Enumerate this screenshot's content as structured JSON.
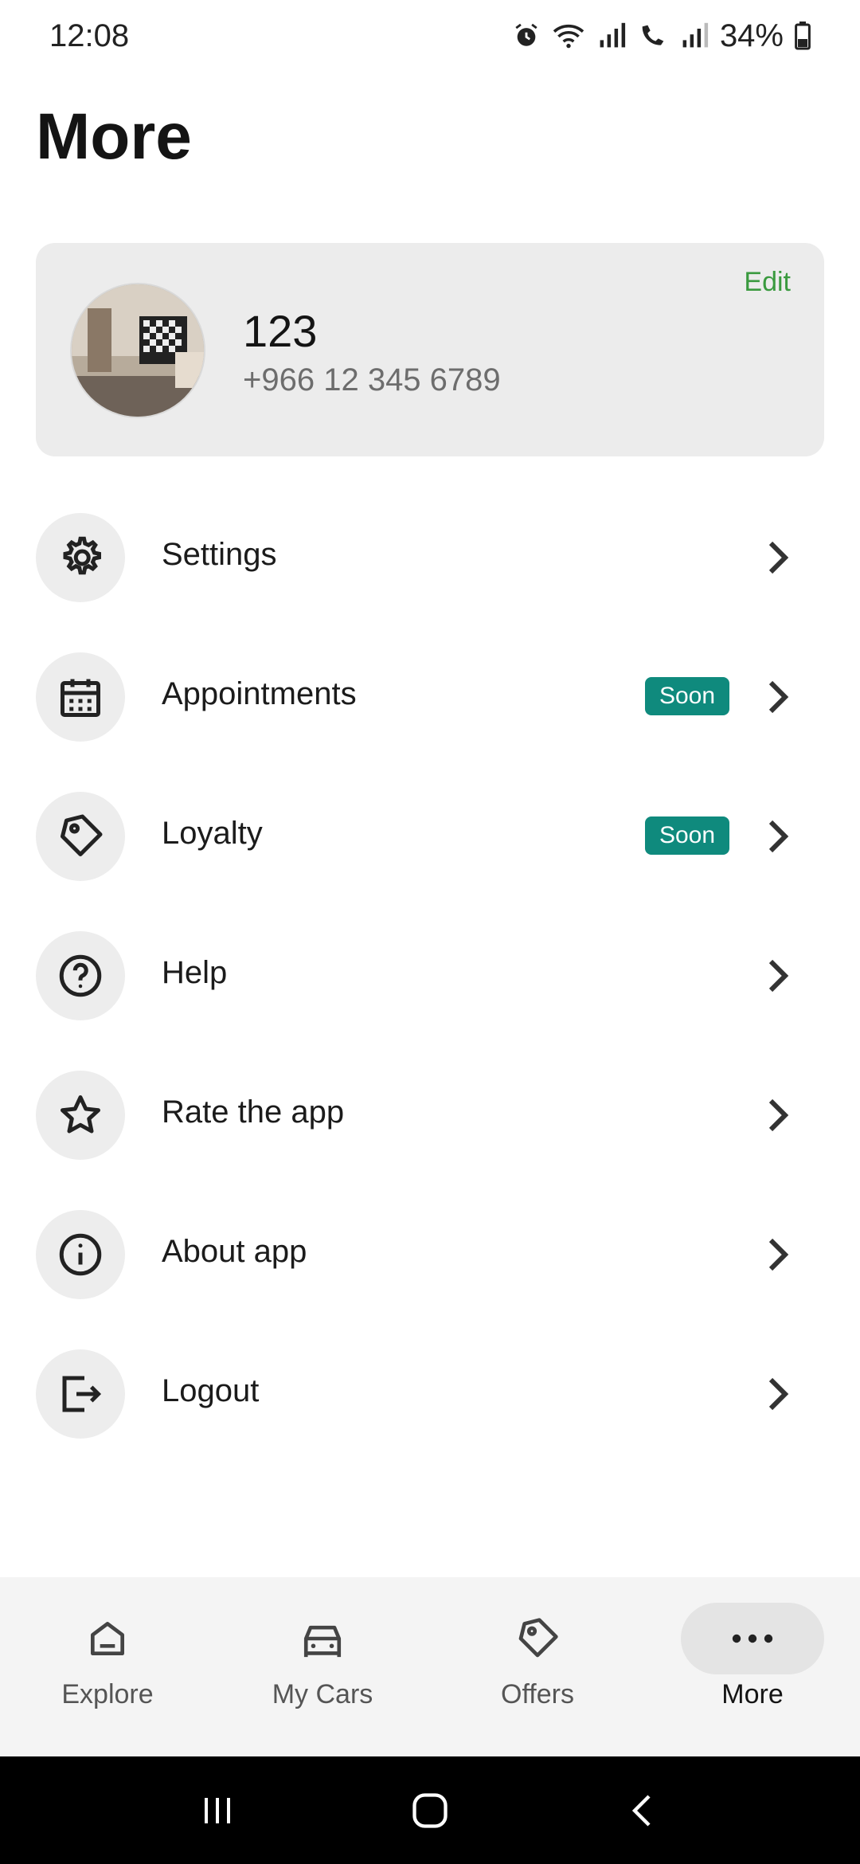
{
  "status_bar": {
    "time": "12:08",
    "battery": "34%"
  },
  "page": {
    "title": "More"
  },
  "profile": {
    "name": "123",
    "phone": "+966 12 345 6789",
    "edit_label": "Edit"
  },
  "menu": {
    "items": [
      {
        "label": "Settings",
        "icon": "gear-icon"
      },
      {
        "label": "Appointments",
        "icon": "calendar-icon",
        "badge": "Soon"
      },
      {
        "label": "Loyalty",
        "icon": "tag-icon",
        "badge": "Soon"
      },
      {
        "label": "Help",
        "icon": "help-circle-icon"
      },
      {
        "label": "Rate the app",
        "icon": "star-icon"
      },
      {
        "label": "About app",
        "icon": "info-icon"
      },
      {
        "label": "Logout",
        "icon": "logout-icon"
      }
    ]
  },
  "bottom_nav": {
    "items": [
      {
        "label": "Explore",
        "icon": "home-icon"
      },
      {
        "label": "My Cars",
        "icon": "car-icon"
      },
      {
        "label": "Offers",
        "icon": "tag-icon"
      },
      {
        "label": "More",
        "icon": "more-dots-icon",
        "active": true
      }
    ]
  },
  "colors": {
    "accent_green": "#3a9a3f",
    "badge_teal": "#0f8a7d"
  }
}
